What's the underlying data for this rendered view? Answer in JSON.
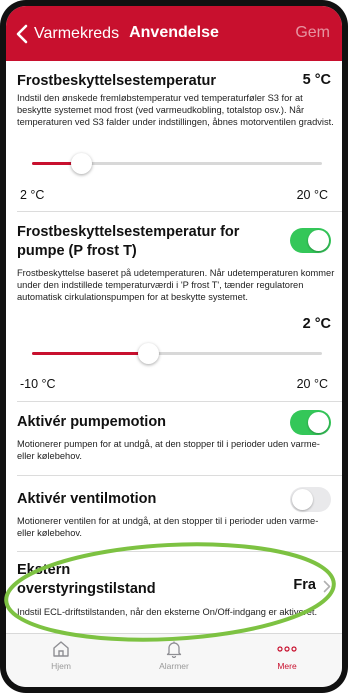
{
  "header": {
    "back_label": "Varmekreds",
    "title": "Anvendelse",
    "save_label": "Gem"
  },
  "sections": {
    "frost_temp": {
      "title": "Frostbeskyttelsestemperatur",
      "value": "5 °C",
      "description": "Indstil den ønskede fremløbstemperatur ved temperaturføler S3 for at beskytte systemet mod frost (ved varmeudkobling, totalstop osv.). Når temperaturen ved S3 falder under indstillingen, åbnes motorventilen gradvist.",
      "slider": {
        "min_label": "2 °C",
        "max_label": "20 °C",
        "level": 0.17
      }
    },
    "frost_pump": {
      "title": "Frostbeskyttelsestemperatur for pumpe (P frost T)",
      "toggle_on": true,
      "description": "Frostbeskyttelse baseret på udetemperaturen. Når udetemperaturen kommer under den indstillede temperaturværdi i 'P frost T', tænder regulatoren automatisk cirkulationspumpen for at beskytte systemet.",
      "value": "2 °C",
      "slider": {
        "min_label": "-10 °C",
        "max_label": "20 °C",
        "level": 0.4
      }
    },
    "pump_motion": {
      "title": "Aktivér pumpemotion",
      "toggle_on": true,
      "description": "Motionerer pumpen for at undgå, at den stopper til i perioder uden varme- eller kølebehov."
    },
    "valve_motion": {
      "title": "Aktivér ventilmotion",
      "toggle_on": false,
      "description": "Motionerer ventilen for at undgå, at den stopper til i perioder uden varme- eller kølebehov."
    },
    "external_override": {
      "title_line1": "Ekstern",
      "title_line2": "overstyringstilstand",
      "value": "Fra",
      "description": "Indstil ECL-driftstilstanden, når den eksterne On/Off-indgang er aktiveret."
    }
  },
  "tabbar": {
    "items": [
      {
        "label": "Hjem",
        "icon": "home-icon",
        "active": false
      },
      {
        "label": "Alarmer",
        "icon": "bell-icon",
        "active": false
      },
      {
        "label": "Mere",
        "icon": "more-icon",
        "active": true
      }
    ]
  },
  "colors": {
    "brand_red": "#c8102e",
    "toggle_on": "#34c759",
    "highlight_ellipse": "#7dc242"
  }
}
